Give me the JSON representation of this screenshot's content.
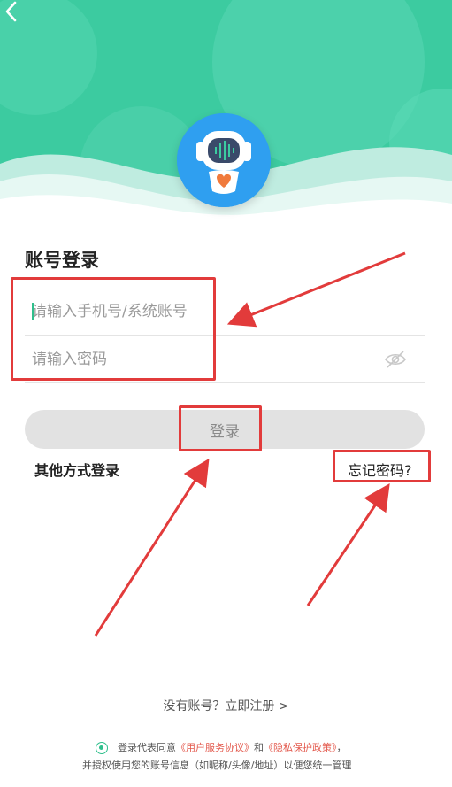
{
  "header": {
    "back_icon": "chevron-left-icon",
    "bg_color": "#3ccba0"
  },
  "login": {
    "title": "账号登录",
    "account_placeholder": "请输入手机号/系统账号",
    "password_placeholder": "请输入密码",
    "login_button": "登录",
    "other_methods": "其他方式登录",
    "forgot_password": "忘记密码?"
  },
  "footer": {
    "register": "没有账号？立即注册 >",
    "agree_prefix": "登录代表同意",
    "agree_link1": "《用户服务协议》",
    "agree_and": "和",
    "agree_link2": "《隐私保护政策》",
    "agree_suffix": "，",
    "agree_line2": "并授权使用您的账号信息（如昵称/头像/地址）以便您统一管理"
  },
  "colors": {
    "accent": "#2fbf8c",
    "annotation_red": "#e23b3b",
    "link_red": "#e35a4e"
  }
}
